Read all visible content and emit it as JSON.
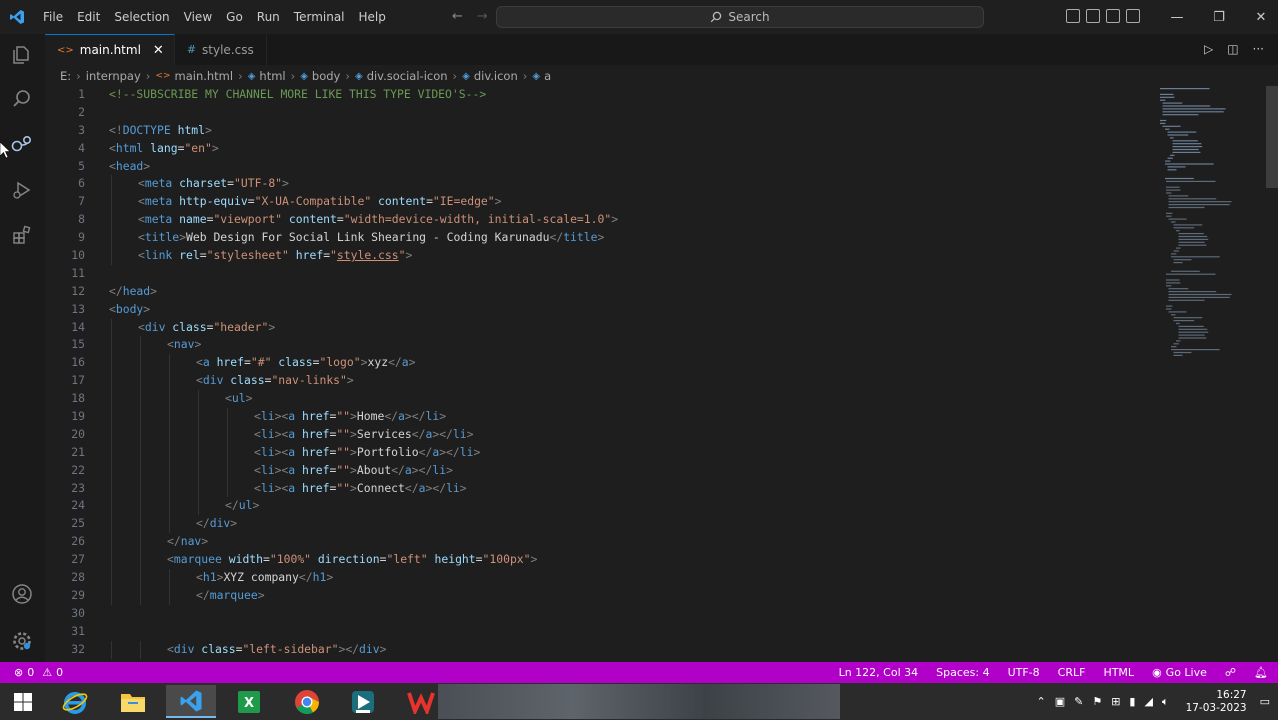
{
  "menu": [
    "File",
    "Edit",
    "Selection",
    "View",
    "Go",
    "Run",
    "Terminal",
    "Help"
  ],
  "search": {
    "label": "Search"
  },
  "tabs": [
    {
      "label": "main.html",
      "active": true
    },
    {
      "label": "style.css",
      "active": false
    }
  ],
  "breadcrumb": [
    "E:",
    "internpay",
    "main.html",
    "html",
    "body",
    "div.social-icon",
    "div.icon",
    "a"
  ],
  "code": [
    {
      "n": "1",
      "i": 0,
      "t": [
        [
          "c",
          "<!--SUBSCRIBE MY CHANNEL MORE LIKE THIS TYPE VIDEO'S-->"
        ]
      ]
    },
    {
      "n": "2",
      "i": 0,
      "t": []
    },
    {
      "n": "3",
      "i": 0,
      "t": [
        [
          "p",
          "<!"
        ],
        [
          "g",
          "DOCTYPE"
        ],
        [
          "a",
          " html"
        ],
        [
          "p",
          ">"
        ]
      ]
    },
    {
      "n": "4",
      "i": 0,
      "t": [
        [
          "p",
          "<"
        ],
        [
          "g",
          "html"
        ],
        [
          "a",
          " lang"
        ],
        [
          "x",
          "="
        ],
        [
          "s",
          "\"en\""
        ],
        [
          "p",
          ">"
        ]
      ]
    },
    {
      "n": "5",
      "i": 0,
      "t": [
        [
          "p",
          "<"
        ],
        [
          "g",
          "head"
        ],
        [
          "p",
          ">"
        ]
      ]
    },
    {
      "n": "6",
      "i": 1,
      "t": [
        [
          "p",
          "<"
        ],
        [
          "g",
          "meta"
        ],
        [
          "a",
          " charset"
        ],
        [
          "x",
          "="
        ],
        [
          "s",
          "\"UTF-8\""
        ],
        [
          "p",
          ">"
        ]
      ]
    },
    {
      "n": "7",
      "i": 1,
      "t": [
        [
          "p",
          "<"
        ],
        [
          "g",
          "meta"
        ],
        [
          "a",
          " http-equiv"
        ],
        [
          "x",
          "="
        ],
        [
          "s",
          "\"X-UA-Compatible\""
        ],
        [
          "a",
          " content"
        ],
        [
          "x",
          "="
        ],
        [
          "s",
          "\"IE=edge\""
        ],
        [
          "p",
          ">"
        ]
      ]
    },
    {
      "n": "8",
      "i": 1,
      "t": [
        [
          "p",
          "<"
        ],
        [
          "g",
          "meta"
        ],
        [
          "a",
          " name"
        ],
        [
          "x",
          "="
        ],
        [
          "s",
          "\"viewport\""
        ],
        [
          "a",
          " content"
        ],
        [
          "x",
          "="
        ],
        [
          "s",
          "\"width=device-width, initial-scale=1.0\""
        ],
        [
          "p",
          ">"
        ]
      ]
    },
    {
      "n": "9",
      "i": 1,
      "t": [
        [
          "p",
          "<"
        ],
        [
          "g",
          "title"
        ],
        [
          "p",
          ">"
        ],
        [
          "x",
          "Web Design For Social Link Shearing - Coding Karunadu"
        ],
        [
          "p",
          "</"
        ],
        [
          "g",
          "title"
        ],
        [
          "p",
          ">"
        ]
      ]
    },
    {
      "n": "10",
      "i": 1,
      "t": [
        [
          "p",
          "<"
        ],
        [
          "g",
          "link"
        ],
        [
          "a",
          " rel"
        ],
        [
          "x",
          "="
        ],
        [
          "s",
          "\"stylesheet\""
        ],
        [
          "a",
          " href"
        ],
        [
          "x",
          "="
        ],
        [
          "s",
          "\""
        ],
        [
          "u",
          "style.css"
        ],
        [
          "s",
          "\""
        ],
        [
          "p",
          ">"
        ]
      ]
    },
    {
      "n": "11",
      "i": 0,
      "t": []
    },
    {
      "n": "12",
      "i": 0,
      "t": [
        [
          "p",
          "</"
        ],
        [
          "g",
          "head"
        ],
        [
          "p",
          ">"
        ]
      ]
    },
    {
      "n": "13",
      "i": 0,
      "t": [
        [
          "p",
          "<"
        ],
        [
          "g",
          "body"
        ],
        [
          "p",
          ">"
        ]
      ]
    },
    {
      "n": "14",
      "i": 1,
      "t": [
        [
          "p",
          "<"
        ],
        [
          "g",
          "div"
        ],
        [
          "a",
          " class"
        ],
        [
          "x",
          "="
        ],
        [
          "s",
          "\"header\""
        ],
        [
          "p",
          ">"
        ]
      ]
    },
    {
      "n": "15",
      "i": 2,
      "t": [
        [
          "p",
          "<"
        ],
        [
          "g",
          "nav"
        ],
        [
          "p",
          ">"
        ]
      ]
    },
    {
      "n": "16",
      "i": 3,
      "t": [
        [
          "p",
          "<"
        ],
        [
          "g",
          "a"
        ],
        [
          "a",
          " href"
        ],
        [
          "x",
          "="
        ],
        [
          "s",
          "\"#\""
        ],
        [
          "a",
          " class"
        ],
        [
          "x",
          "="
        ],
        [
          "s",
          "\"logo\""
        ],
        [
          "p",
          ">"
        ],
        [
          "x",
          "xyz"
        ],
        [
          "p",
          "</"
        ],
        [
          "g",
          "a"
        ],
        [
          "p",
          ">"
        ]
      ]
    },
    {
      "n": "17",
      "i": 3,
      "t": [
        [
          "p",
          "<"
        ],
        [
          "g",
          "div"
        ],
        [
          "a",
          " class"
        ],
        [
          "x",
          "="
        ],
        [
          "s",
          "\"nav-links\""
        ],
        [
          "p",
          ">"
        ]
      ]
    },
    {
      "n": "18",
      "i": 4,
      "t": [
        [
          "p",
          "<"
        ],
        [
          "g",
          "ul"
        ],
        [
          "p",
          ">"
        ]
      ]
    },
    {
      "n": "19",
      "i": 5,
      "t": [
        [
          "p",
          "<"
        ],
        [
          "g",
          "li"
        ],
        [
          "p",
          "><"
        ],
        [
          "g",
          "a"
        ],
        [
          "a",
          " href"
        ],
        [
          "x",
          "="
        ],
        [
          "s",
          "\"\""
        ],
        [
          "p",
          ">"
        ],
        [
          "x",
          "Home"
        ],
        [
          "p",
          "</"
        ],
        [
          "g",
          "a"
        ],
        [
          "p",
          "></"
        ],
        [
          "g",
          "li"
        ],
        [
          "p",
          ">"
        ]
      ]
    },
    {
      "n": "20",
      "i": 5,
      "t": [
        [
          "p",
          "<"
        ],
        [
          "g",
          "li"
        ],
        [
          "p",
          "><"
        ],
        [
          "g",
          "a"
        ],
        [
          "a",
          " href"
        ],
        [
          "x",
          "="
        ],
        [
          "s",
          "\"\""
        ],
        [
          "p",
          ">"
        ],
        [
          "x",
          "Services"
        ],
        [
          "p",
          "</"
        ],
        [
          "g",
          "a"
        ],
        [
          "p",
          "></"
        ],
        [
          "g",
          "li"
        ],
        [
          "p",
          ">"
        ]
      ]
    },
    {
      "n": "21",
      "i": 5,
      "t": [
        [
          "p",
          "<"
        ],
        [
          "g",
          "li"
        ],
        [
          "p",
          "><"
        ],
        [
          "g",
          "a"
        ],
        [
          "a",
          " href"
        ],
        [
          "x",
          "="
        ],
        [
          "s",
          "\"\""
        ],
        [
          "p",
          ">"
        ],
        [
          "x",
          "Portfolio"
        ],
        [
          "p",
          "</"
        ],
        [
          "g",
          "a"
        ],
        [
          "p",
          "></"
        ],
        [
          "g",
          "li"
        ],
        [
          "p",
          ">"
        ]
      ]
    },
    {
      "n": "22",
      "i": 5,
      "t": [
        [
          "p",
          "<"
        ],
        [
          "g",
          "li"
        ],
        [
          "p",
          "><"
        ],
        [
          "g",
          "a"
        ],
        [
          "a",
          " href"
        ],
        [
          "x",
          "="
        ],
        [
          "s",
          "\"\""
        ],
        [
          "p",
          ">"
        ],
        [
          "x",
          "About"
        ],
        [
          "p",
          "</"
        ],
        [
          "g",
          "a"
        ],
        [
          "p",
          "></"
        ],
        [
          "g",
          "li"
        ],
        [
          "p",
          ">"
        ]
      ]
    },
    {
      "n": "23",
      "i": 5,
      "t": [
        [
          "p",
          "<"
        ],
        [
          "g",
          "li"
        ],
        [
          "p",
          "><"
        ],
        [
          "g",
          "a"
        ],
        [
          "a",
          " href"
        ],
        [
          "x",
          "="
        ],
        [
          "s",
          "\"\""
        ],
        [
          "p",
          ">"
        ],
        [
          "x",
          "Connect"
        ],
        [
          "p",
          "</"
        ],
        [
          "g",
          "a"
        ],
        [
          "p",
          "></"
        ],
        [
          "g",
          "li"
        ],
        [
          "p",
          ">"
        ]
      ]
    },
    {
      "n": "24",
      "i": 4,
      "t": [
        [
          "p",
          "</"
        ],
        [
          "g",
          "ul"
        ],
        [
          "p",
          ">"
        ]
      ]
    },
    {
      "n": "25",
      "i": 3,
      "t": [
        [
          "p",
          "</"
        ],
        [
          "g",
          "div"
        ],
        [
          "p",
          ">"
        ]
      ]
    },
    {
      "n": "26",
      "i": 2,
      "t": [
        [
          "p",
          "</"
        ],
        [
          "g",
          "nav"
        ],
        [
          "p",
          ">"
        ]
      ]
    },
    {
      "n": "27",
      "i": 2,
      "t": [
        [
          "p",
          "<"
        ],
        [
          "g",
          "marquee"
        ],
        [
          "a",
          " width"
        ],
        [
          "x",
          "="
        ],
        [
          "s",
          "\"100%\""
        ],
        [
          "a",
          " direction"
        ],
        [
          "x",
          "="
        ],
        [
          "s",
          "\"left\""
        ],
        [
          "a",
          " height"
        ],
        [
          "x",
          "="
        ],
        [
          "s",
          "\"100px\""
        ],
        [
          "p",
          ">"
        ]
      ]
    },
    {
      "n": "28",
      "i": 3,
      "t": [
        [
          "p",
          "<"
        ],
        [
          "g",
          "h1"
        ],
        [
          "p",
          ">"
        ],
        [
          "x",
          "XYZ company"
        ],
        [
          "p",
          "</"
        ],
        [
          "g",
          "h1"
        ],
        [
          "p",
          ">"
        ]
      ]
    },
    {
      "n": "29",
      "i": 3,
      "t": [
        [
          "p",
          "</"
        ],
        [
          "g",
          "marquee"
        ],
        [
          "p",
          ">"
        ]
      ]
    },
    {
      "n": "30",
      "i": 0,
      "t": []
    },
    {
      "n": "31",
      "i": 0,
      "t": []
    },
    {
      "n": "32",
      "i": 2,
      "t": [
        [
          "p",
          "<"
        ],
        [
          "g",
          "div"
        ],
        [
          "a",
          " class"
        ],
        [
          "x",
          "="
        ],
        [
          "s",
          "\"left-sidebar\""
        ],
        [
          "p",
          "></"
        ],
        [
          "g",
          "div"
        ],
        [
          "p",
          ">"
        ]
      ]
    }
  ],
  "status": {
    "errors": "0",
    "warnings": "0",
    "position": "Ln 122, Col 34",
    "spaces": "Spaces: 4",
    "encoding": "UTF-8",
    "eol": "CRLF",
    "language": "HTML",
    "golive": "Go Live"
  },
  "clock": {
    "time": "16:27",
    "date": "17-03-2023"
  },
  "colors": {
    "status_bar": "#b100c8",
    "accent": "#0078d4"
  }
}
